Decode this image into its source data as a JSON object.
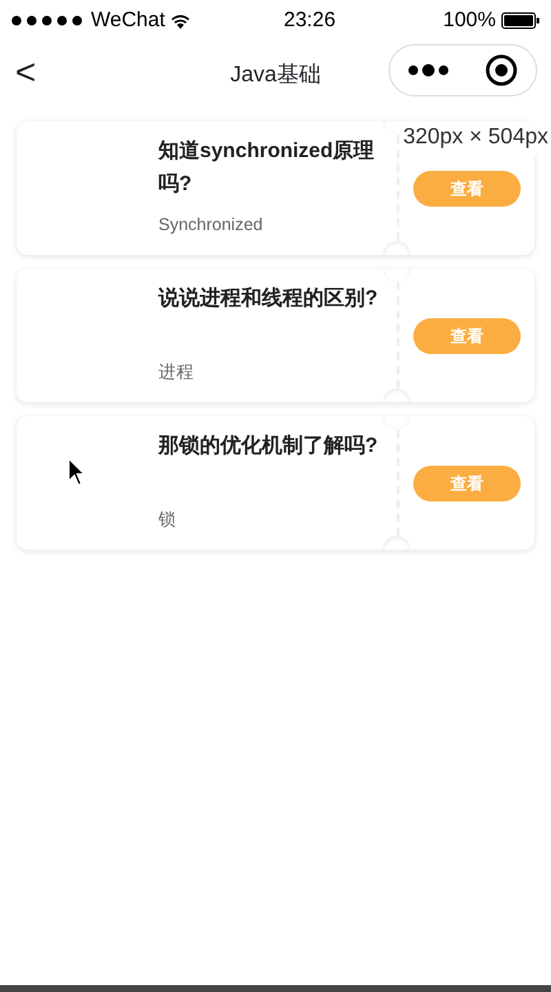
{
  "status_bar": {
    "carrier": "WeChat",
    "time": "23:26",
    "battery": "100%"
  },
  "nav": {
    "title": "Java基础",
    "back": "<"
  },
  "size_tooltip": "320px × 504px",
  "cards": [
    {
      "title": "知道synchronized原理吗?",
      "tag": "Synchronized",
      "button": "查看"
    },
    {
      "title": "说说进程和线程的区别?",
      "tag": "进程",
      "button": "查看"
    },
    {
      "title": "那锁的优化机制了解吗?",
      "tag": "锁",
      "button": "查看"
    }
  ]
}
